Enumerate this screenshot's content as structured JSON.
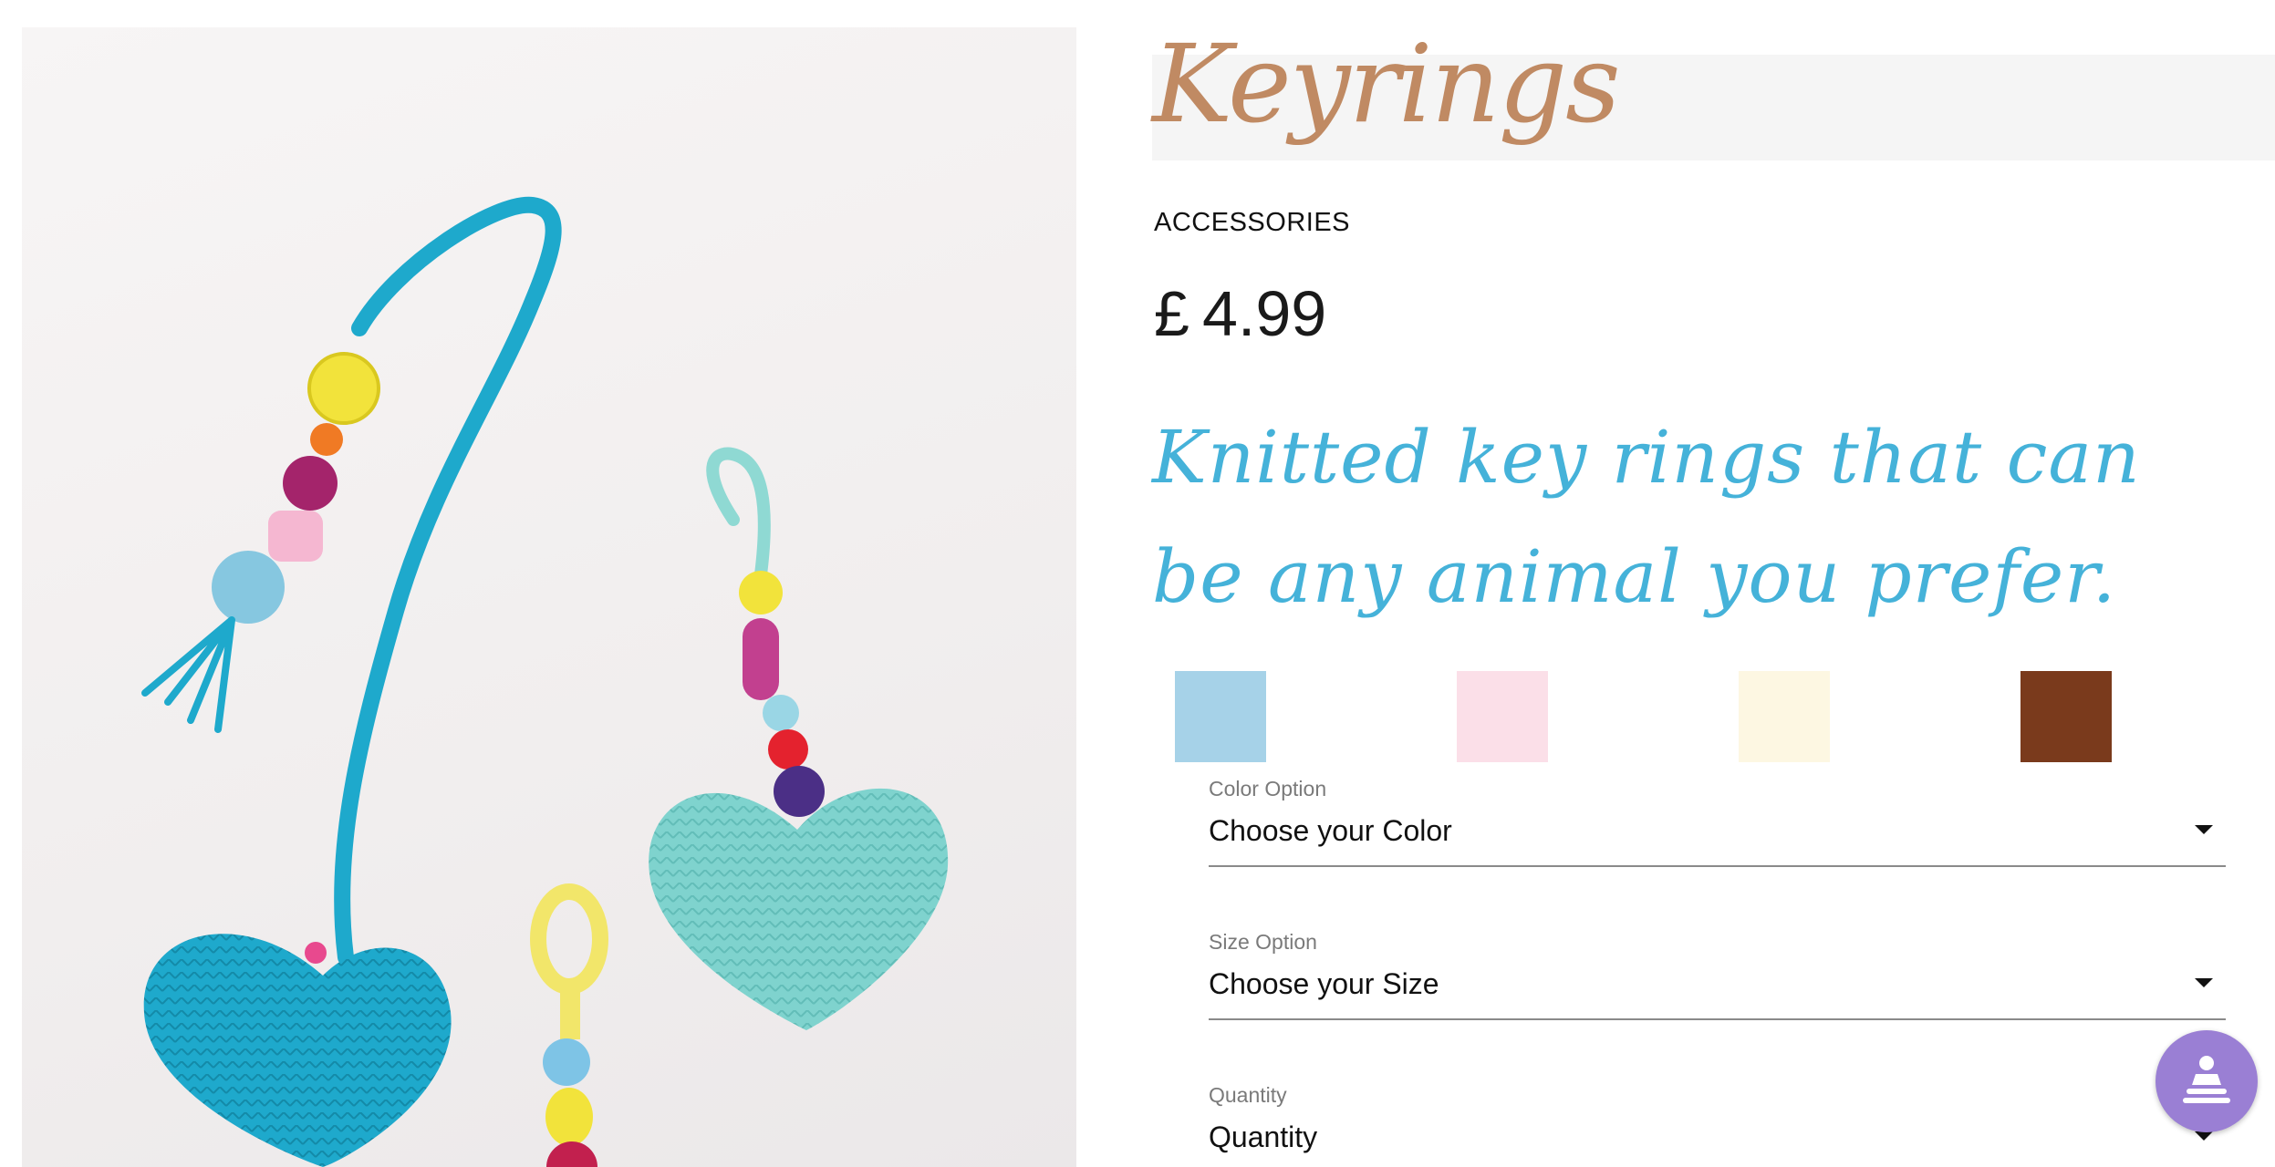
{
  "product": {
    "title": "Keyrings",
    "category": "ACCESSORIES",
    "currency": "£",
    "price": "4.99",
    "description": "Knitted key rings that can be any animal you prefer."
  },
  "image": {
    "icon": "knitted-heart-keyrings-photo"
  },
  "swatches": [
    {
      "name": "blue",
      "color": "#a6d2e8"
    },
    {
      "name": "pink",
      "color": "#fbdfe8"
    },
    {
      "name": "cream",
      "color": "#fdf7e2"
    },
    {
      "name": "brown",
      "color": "#7a3a1c"
    }
  ],
  "fields": {
    "color": {
      "label": "Color Option",
      "value": "Choose your Color"
    },
    "size": {
      "label": "Size Option",
      "value": "Choose your Size"
    },
    "quantity": {
      "label": "Quantity",
      "value": "Quantity"
    }
  },
  "fab": {
    "icon": "help-person-icon",
    "color": "#9a7fd4"
  },
  "theme": {
    "title_color": "#c08a63",
    "description_color": "#45b2d9"
  }
}
